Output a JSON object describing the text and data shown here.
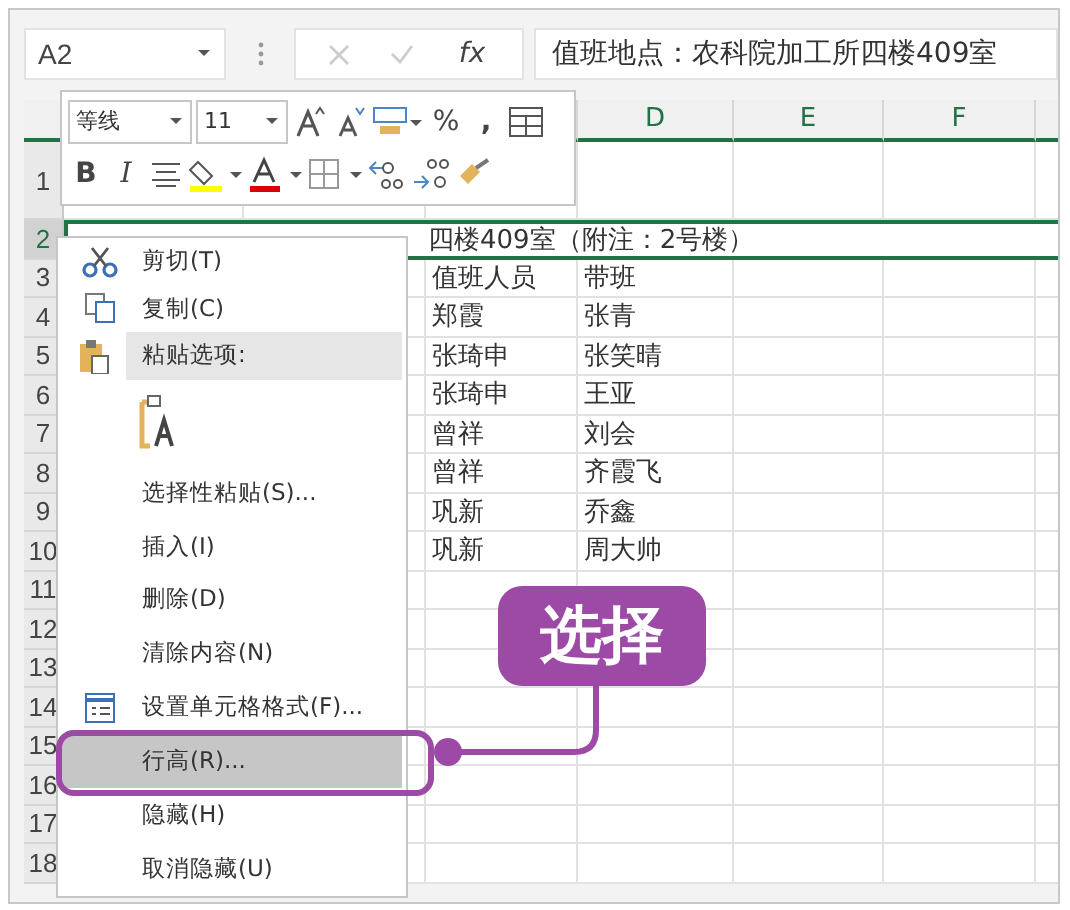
{
  "name_box": {
    "value": "A2"
  },
  "formula_bar": {
    "fx": "fx",
    "value": "值班地点：农科院加工所四楼409室"
  },
  "mini_toolbar": {
    "font": "等线",
    "size": "11",
    "percent": "%",
    "comma": ",",
    "bold": "B",
    "italic": "I"
  },
  "column_headers": [
    "D",
    "E",
    "F"
  ],
  "rows": [
    {
      "number": "1",
      "selected": false,
      "cells": []
    },
    {
      "number": "2",
      "selected": true,
      "cells": [],
      "text": "四楼409室（附注：2号楼）"
    },
    {
      "number": "3",
      "selected": false,
      "cells": [
        "值班人员",
        "带班"
      ]
    },
    {
      "number": "4",
      "selected": false,
      "cells": [
        "郑霞",
        "张青"
      ]
    },
    {
      "number": "5",
      "selected": false,
      "cells": [
        "张琦申",
        "张笑晴"
      ]
    },
    {
      "number": "6",
      "selected": false,
      "cells": [
        "张琦申",
        "王亚"
      ]
    },
    {
      "number": "7",
      "selected": false,
      "cells": [
        "曾祥",
        "刘会"
      ]
    },
    {
      "number": "8",
      "selected": false,
      "cells": [
        "曾祥",
        "齐霞飞"
      ]
    },
    {
      "number": "9",
      "selected": false,
      "cells": [
        "巩新",
        "乔鑫"
      ]
    },
    {
      "number": "10",
      "selected": false,
      "cells": [
        "巩新",
        "周大帅"
      ]
    },
    {
      "number": "11",
      "selected": false,
      "cells": []
    },
    {
      "number": "12",
      "selected": false,
      "cells": []
    },
    {
      "number": "13",
      "selected": false,
      "cells": []
    },
    {
      "number": "14",
      "selected": false,
      "cells": []
    },
    {
      "number": "15",
      "selected": false,
      "cells": []
    },
    {
      "number": "16",
      "selected": false,
      "cells": []
    },
    {
      "number": "17",
      "selected": false,
      "cells": []
    },
    {
      "number": "18",
      "selected": false,
      "cells": []
    }
  ],
  "context_menu": {
    "items": [
      {
        "kind": "item",
        "label": "剪切(T)",
        "selected": false
      },
      {
        "kind": "item",
        "label": "复制(C)",
        "selected": false
      },
      {
        "kind": "header",
        "label": "粘贴选项:",
        "selected": false
      },
      {
        "kind": "paste-icons",
        "selected": false
      },
      {
        "kind": "item",
        "label": "选择性粘贴(S)...",
        "selected": false
      },
      {
        "kind": "item",
        "label": "插入(I)",
        "selected": false
      },
      {
        "kind": "item",
        "label": "删除(D)",
        "selected": false
      },
      {
        "kind": "item",
        "label": "清除内容(N)",
        "selected": false
      },
      {
        "kind": "item",
        "label": "设置单元格格式(F)...",
        "selected": false
      },
      {
        "kind": "item",
        "label": "行高(R)...",
        "selected": true
      },
      {
        "kind": "item",
        "label": "隐藏(H)",
        "selected": false
      },
      {
        "kind": "item",
        "label": "取消隐藏(U)",
        "selected": false
      }
    ]
  },
  "callout": {
    "text": "选择"
  }
}
